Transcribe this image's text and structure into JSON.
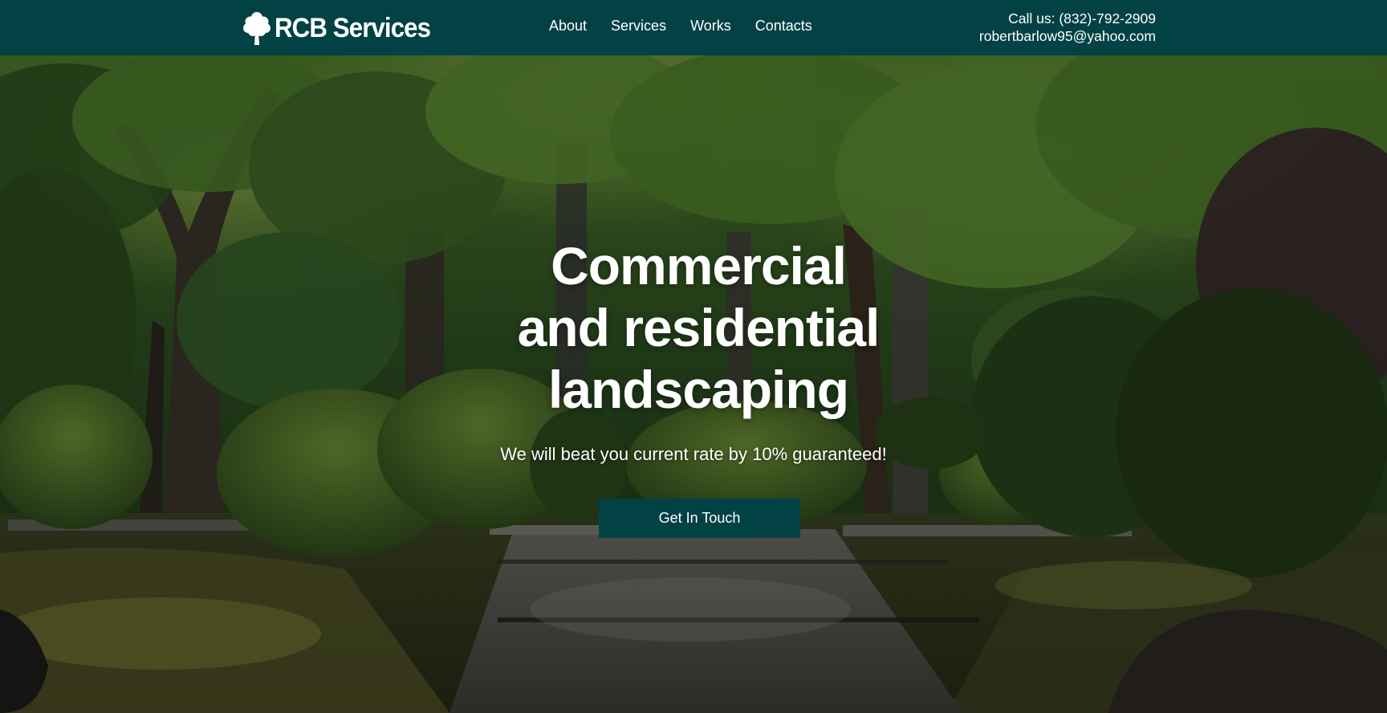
{
  "header": {
    "logo_text": "RCB Services",
    "logo_icon": "tree-icon",
    "nav": [
      {
        "label": "About"
      },
      {
        "label": "Services"
      },
      {
        "label": "Works"
      },
      {
        "label": "Contacts"
      }
    ],
    "phone": "Call us: (832)-792-2909",
    "email": "robertbarlow95@yahoo.com"
  },
  "hero": {
    "headline_lines": [
      "Commercial",
      "and residential",
      "landscaping"
    ],
    "tagline": "We will beat you current rate by 10% guaranteed!",
    "cta_label": "Get In Touch"
  },
  "colors": {
    "header_bg": "#034244",
    "button_bg": "#034244",
    "text": "#ffffff"
  }
}
